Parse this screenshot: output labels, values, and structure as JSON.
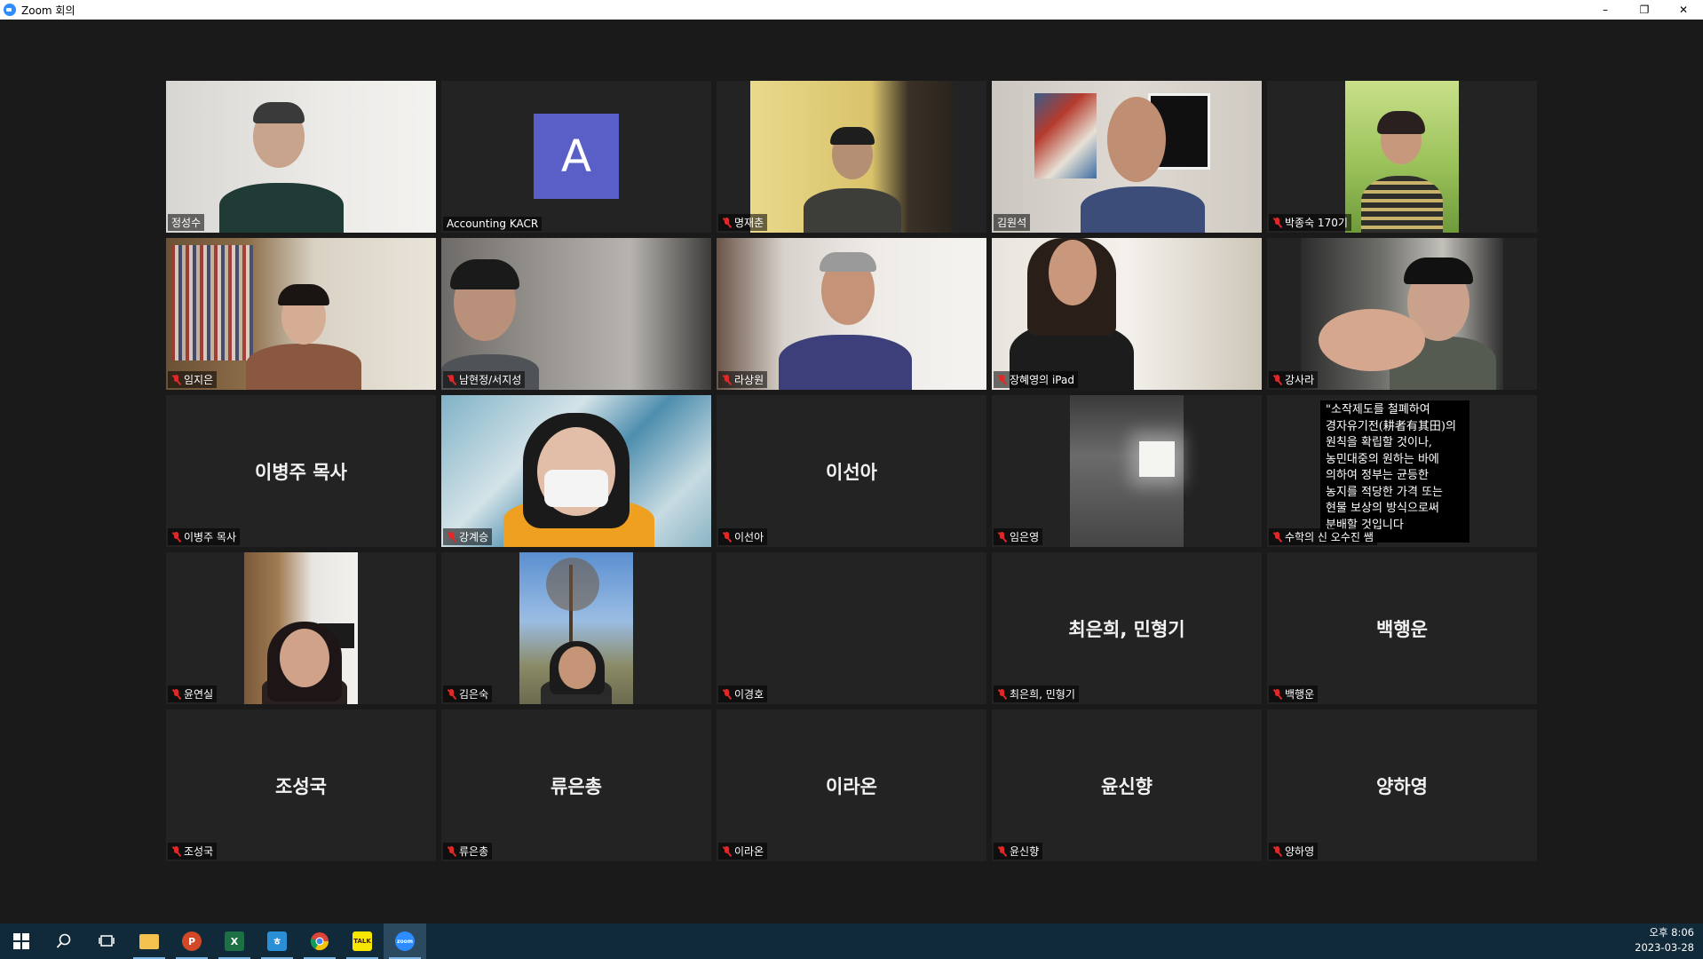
{
  "window": {
    "title": "Zoom 회의",
    "controls": {
      "minimize": "–",
      "restore": "❐",
      "close": "✕"
    }
  },
  "participants": [
    {
      "name": "정성수",
      "muted": false,
      "video": true
    },
    {
      "name": "Accounting KACR",
      "muted": false,
      "video": false,
      "avatar_letter": "A",
      "avatar_color": "#5a5fc7"
    },
    {
      "name": "명재춘",
      "muted": true,
      "video": true
    },
    {
      "name": "김원석",
      "muted": false,
      "video": true,
      "speaking": true
    },
    {
      "name": "박종숙 170기",
      "muted": true,
      "video": true
    },
    {
      "name": "임지은",
      "muted": true,
      "video": true
    },
    {
      "name": "남현정/서지성",
      "muted": true,
      "video": true
    },
    {
      "name": "라상원",
      "muted": true,
      "video": true
    },
    {
      "name": "장혜영의 iPad",
      "muted": true,
      "video": true
    },
    {
      "name": "강사라",
      "muted": true,
      "video": true
    },
    {
      "name": "이병주 목사",
      "muted": true,
      "video": false
    },
    {
      "name": "강계승",
      "muted": true,
      "video": true
    },
    {
      "name": "이선아",
      "muted": true,
      "video": false
    },
    {
      "name": "임은영",
      "muted": true,
      "video": true
    },
    {
      "name": "수학의 신 오수진 쌤",
      "muted": true,
      "video": true,
      "screen_text": "\"소작제도를 철폐하여\n경자유기전(耕者有其田)의\n원칙을 확립할 것이나,\n농민대중의 원하는 바에\n의하여 정부는 균등한\n농지를 적당한 가격 또는\n현물 보상의 방식으로써\n분배할 것입니다"
    },
    {
      "name": "윤연실",
      "muted": true,
      "video": true
    },
    {
      "name": "김은숙",
      "muted": true,
      "video": true
    },
    {
      "name": "이경호",
      "muted": true,
      "video": false,
      "show_big": false
    },
    {
      "name": "최은희, 민형기",
      "muted": true,
      "video": false
    },
    {
      "name": "백행운",
      "muted": true,
      "video": false
    },
    {
      "name": "조성국",
      "muted": true,
      "video": false
    },
    {
      "name": "류은총",
      "muted": true,
      "video": false
    },
    {
      "name": "이라온",
      "muted": true,
      "video": false
    },
    {
      "name": "윤신향",
      "muted": true,
      "video": false
    },
    {
      "name": "양하영",
      "muted": true,
      "video": false
    }
  ],
  "taskbar": {
    "apps": [
      {
        "icon": "windows-start-icon"
      },
      {
        "icon": "search-icon"
      },
      {
        "icon": "task-view-icon"
      },
      {
        "icon": "file-explorer-icon",
        "color": "#f2c14e"
      },
      {
        "icon": "powerpoint-icon",
        "color": "#d24726",
        "glyph": "P"
      },
      {
        "icon": "excel-icon",
        "color": "#1d7044",
        "glyph": "X"
      },
      {
        "icon": "hancom-icon",
        "color": "#2b8fd6",
        "glyph": "ㅎ"
      },
      {
        "icon": "chrome-icon"
      },
      {
        "icon": "kakaotalk-icon",
        "color": "#f7e600",
        "glyph": "TALK"
      },
      {
        "icon": "zoom-icon",
        "color": "#2d8cff",
        "glyph": "zoom"
      }
    ],
    "time": "오후 8:06",
    "date": "2023-03-28"
  }
}
